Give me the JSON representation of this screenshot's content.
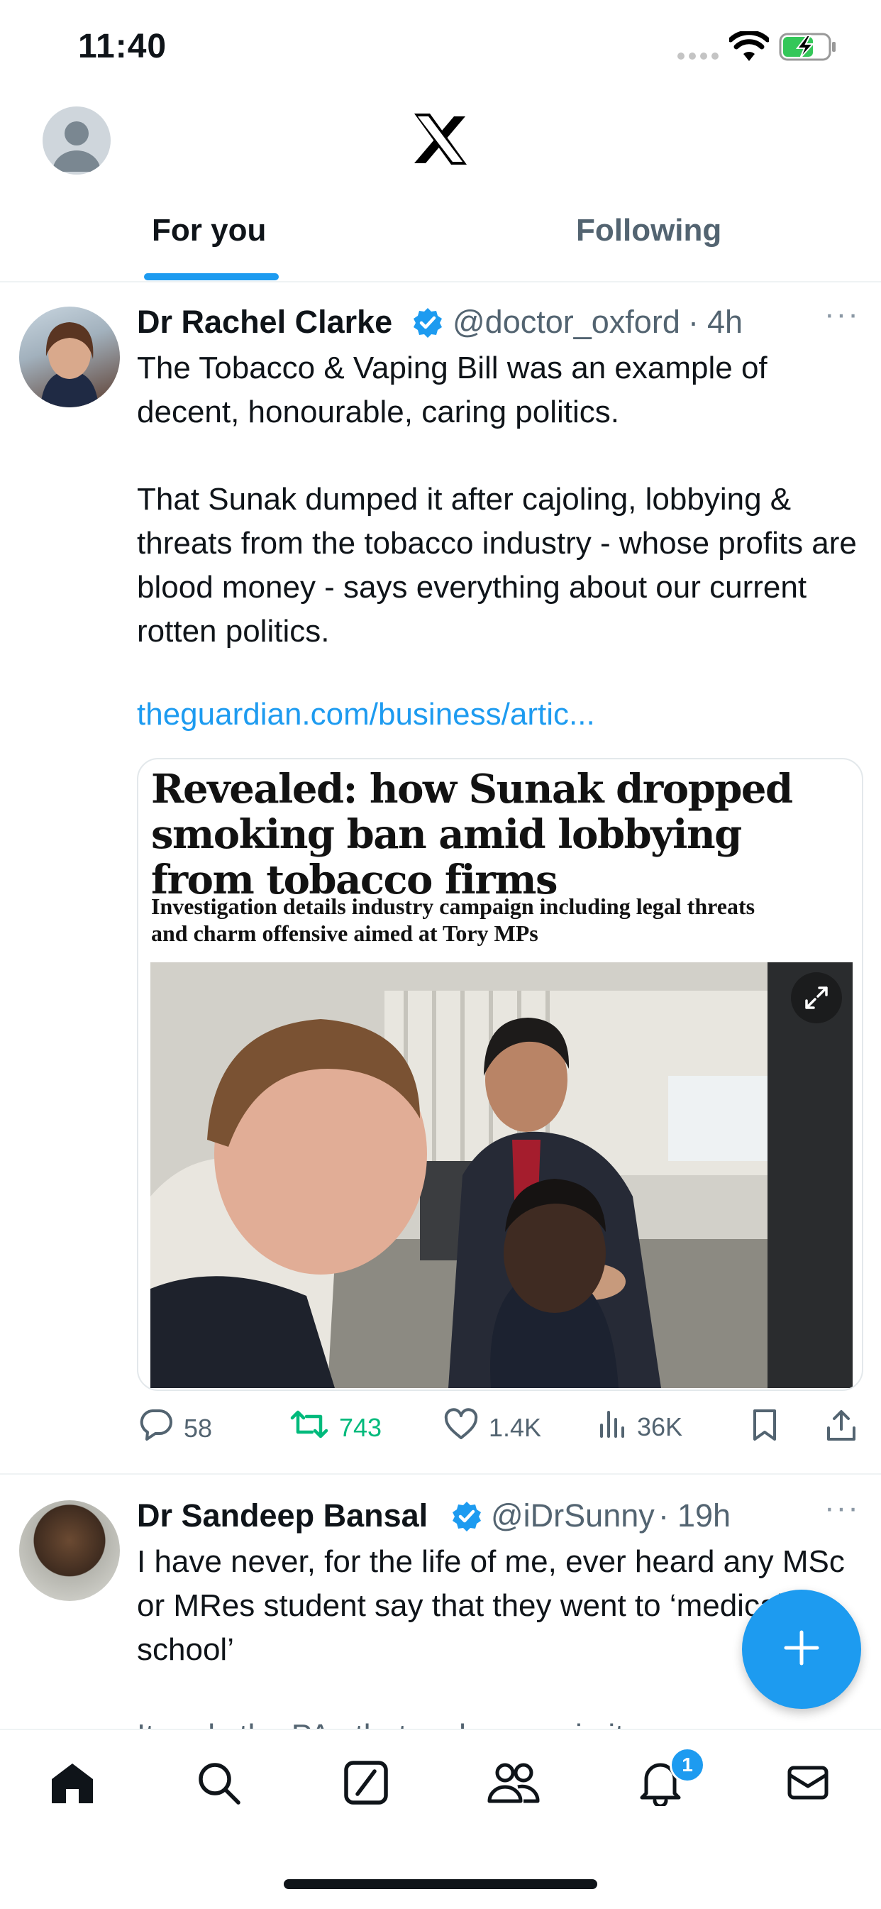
{
  "status_bar": {
    "time": "11:40"
  },
  "header": {
    "logo": "x-logo",
    "tabs": [
      {
        "label": "For you",
        "active": true
      },
      {
        "label": "Following",
        "active": false
      }
    ]
  },
  "posts": [
    {
      "author": "Dr Rachel Clarke",
      "handle": "@doctor_oxford",
      "separator": "·",
      "time": "4h",
      "more": "···",
      "paragraphs": [
        "The Tobacco & Vaping Bill was an example of decent, honourable, caring politics.",
        "That Sunak dumped it after cajoling, lobbying & threats from the tobacco industry - whose profits are blood money - says everything about our current rotten politics."
      ],
      "link": "theguardian.com/business/artic...",
      "card": {
        "headline": "Revealed: how Sunak dropped smoking ban amid lobbying from tobacco firms",
        "standfirst": "Investigation details industry campaign including legal threats and charm offensive aimed at Tory MPs"
      },
      "stats": {
        "replies": "58",
        "reposts": "743",
        "likes": "1.4K",
        "views": "36K"
      }
    },
    {
      "author": "Dr Sandeep Bansal",
      "handle": "@iDrSunny",
      "separator": "·",
      "time": "19h",
      "more": "···",
      "paragraphs": [
        "I have never, for the life of me, ever heard any MSc or MRes student say that they went to ‘medical school’",
        "It ends the PAs that make so vain it..."
      ]
    }
  ],
  "notifications_badge": "1",
  "colors": {
    "accent": "#1d9bf0",
    "repost_active": "#00ba7c",
    "secondary_text": "#536471"
  }
}
